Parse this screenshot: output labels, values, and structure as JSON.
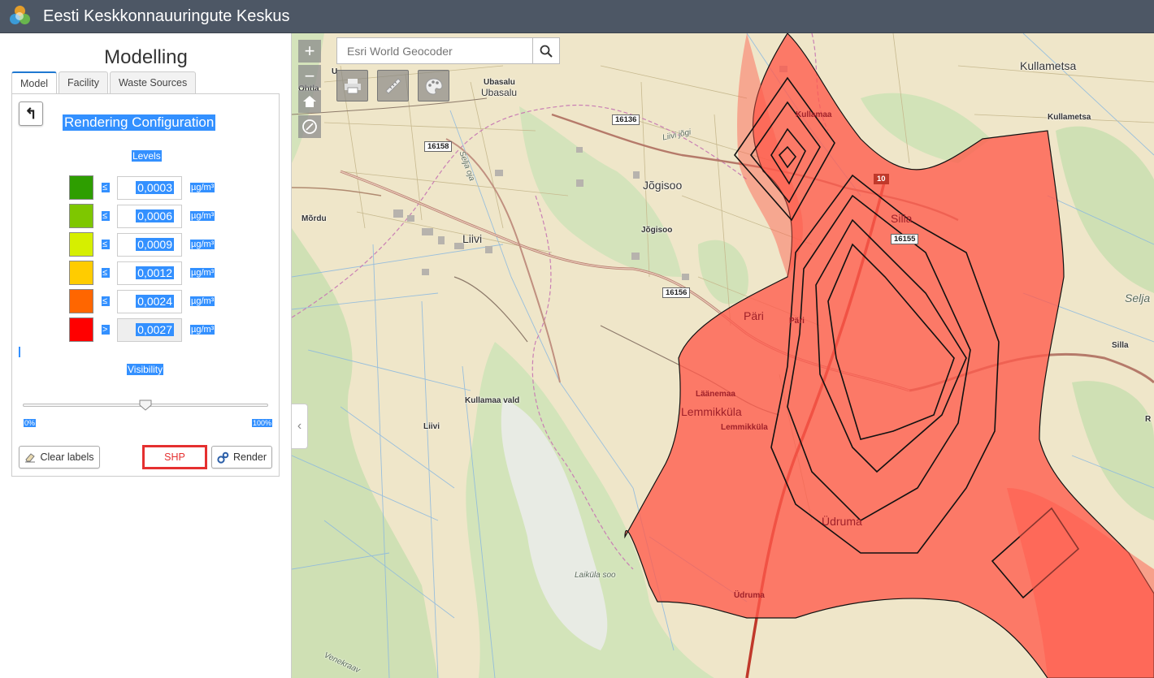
{
  "app": {
    "title": "Eesti Keskkonnauuringute Keskus"
  },
  "panel": {
    "title": "Modelling",
    "tabs": [
      {
        "label": "Model",
        "active": true
      },
      {
        "label": "Facility",
        "active": false
      },
      {
        "label": "Waste Sources",
        "active": false
      }
    ],
    "back_icon": "↰",
    "rendering_title": "Rendering Configuration",
    "levels_label": "Levels",
    "levels": [
      {
        "color": "#2e9e00",
        "op": "≤",
        "value": "0,0003",
        "unit": "µg/m³"
      },
      {
        "color": "#7ec700",
        "op": "≤",
        "value": "0,0006",
        "unit": "µg/m³"
      },
      {
        "color": "#d6ef00",
        "op": "≤",
        "value": "0,0009",
        "unit": "µg/m³"
      },
      {
        "color": "#ffcc00",
        "op": "≤",
        "value": "0,0012",
        "unit": "µg/m³"
      },
      {
        "color": "#ff6600",
        "op": "≤",
        "value": "0,0024",
        "unit": "µg/m³"
      },
      {
        "color": "#ff0000",
        "op": ">",
        "value": "0,0027",
        "unit": "µg/m³"
      }
    ],
    "visibility_label": "Visibility",
    "visibility_value": 0.5,
    "visibility_min": "0%",
    "visibility_max": "100%",
    "buttons": {
      "clear_labels": "Clear labels",
      "shp": "SHP",
      "render": "Render"
    }
  },
  "map": {
    "search_placeholder": "Esri World Geocoder",
    "zoom_in": "+",
    "zoom_out": "−",
    "plume_color": "#ff5a4c",
    "labels": {
      "ubasalu_a": "Ubasalu",
      "ubasalu_b": "Ubasalu",
      "ohtla": "Ohtla",
      "kullametsa_a": "Kullametsa",
      "kullametsa_b": "Kullametsa",
      "kullamaa": "Kullamaa",
      "jogisoo_a": "Jõgisoo",
      "jogisoo_b": "Jõgisoo",
      "mordu": "Mõrdu",
      "liivi_a": "Liivi",
      "liivi_b": "Liivi",
      "silla_a": "Silla",
      "silla_b": "Silla",
      "selja": "Selja",
      "pari_a": "Päri",
      "pari_b": "Päri",
      "laanemaa": "Läänemaa",
      "lemmikkula_a": "Lemmikküla",
      "lemmikkula_b": "Lemmikküla",
      "kullamaa_vald": "Kullamaa vald",
      "udruma_a": "Üdruma",
      "udruma_b": "Üdruma",
      "laikula_soo": "Laiküla soo",
      "liivi_jogi": "Liivi jõgi",
      "selja_oja": "Selja oja",
      "venekraav": "Venekraav",
      "edge_r": "R",
      "edge_u": "U"
    },
    "roads": {
      "r16136": "16136",
      "r16158": "16158",
      "r10": "10",
      "r16155": "16155",
      "r16156": "16156"
    }
  }
}
